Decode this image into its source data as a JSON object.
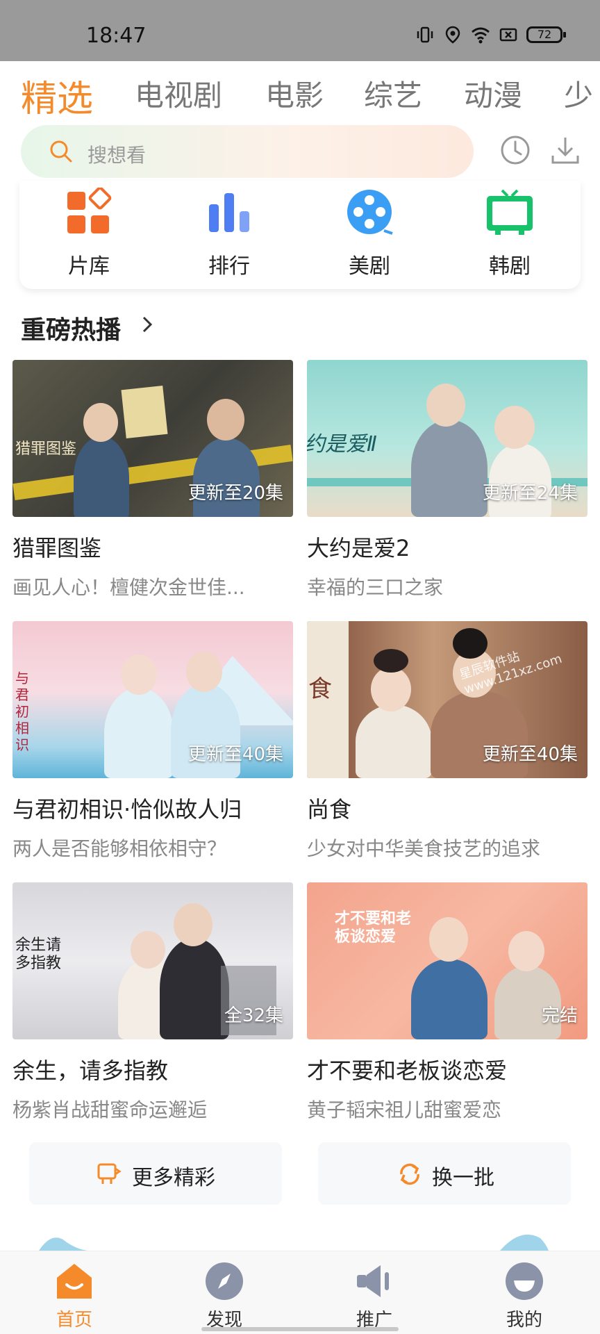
{
  "status_bar": {
    "time": "18:47",
    "battery": "72"
  },
  "tabs": [
    {
      "label": "精选",
      "active": true
    },
    {
      "label": "电视剧"
    },
    {
      "label": "电影"
    },
    {
      "label": "综艺"
    },
    {
      "label": "动漫"
    },
    {
      "label": "少儿"
    }
  ],
  "search": {
    "placeholder": "搜想看",
    "icons": [
      "history-icon",
      "download-icon"
    ]
  },
  "categories": [
    {
      "label": "片库",
      "icon": "grid-icon",
      "color": "#f36b2a"
    },
    {
      "label": "排行",
      "icon": "bar-chart-icon",
      "color": "#4f7ef3"
    },
    {
      "label": "美剧",
      "icon": "film-reel-icon",
      "color": "#3a9ef5"
    },
    {
      "label": "韩剧",
      "icon": "tv-icon",
      "color": "#17c26b"
    }
  ],
  "section": {
    "title": "重磅热播"
  },
  "videos": [
    {
      "title": "猎罪图鉴",
      "subtitle": "画见人心！檀健次金世佳...",
      "episode": "更新至20集",
      "poster_text": "猎罪图鉴"
    },
    {
      "title": "大约是爱2",
      "subtitle": "幸福的三口之家",
      "episode": "更新至24集",
      "poster_text": "约是爱Ⅱ"
    },
    {
      "title": "与君初相识·恰似故人归",
      "subtitle": "两人是否能够相依相守？",
      "episode": "更新至40集",
      "poster_text": "与君初相识"
    },
    {
      "title": "尚食",
      "subtitle": "少女对中华美食技艺的追求",
      "episode": "更新至40集",
      "poster_text": "食",
      "watermark": "星辰软件站 www.121xz.com"
    },
    {
      "title": "余生，请多指教",
      "subtitle": "杨紫肖战甜蜜命运邂逅",
      "episode": "全32集",
      "poster_text": "余生请多指教"
    },
    {
      "title": "才不要和老板谈恋爱",
      "subtitle": "黄子韬宋祖儿甜蜜爱恋",
      "episode": "完结",
      "poster_text": "才不要和老板谈恋爱"
    }
  ],
  "actions": {
    "more": "更多精彩",
    "refresh": "换一批"
  },
  "bottom_nav": [
    {
      "label": "首页",
      "icon": "home-icon",
      "active": true
    },
    {
      "label": "发现",
      "icon": "compass-icon"
    },
    {
      "label": "推广",
      "icon": "megaphone-icon"
    },
    {
      "label": "我的",
      "icon": "profile-icon"
    }
  ],
  "colors": {
    "accent": "#f58a2a",
    "statusbar": "#9a9a9a"
  }
}
